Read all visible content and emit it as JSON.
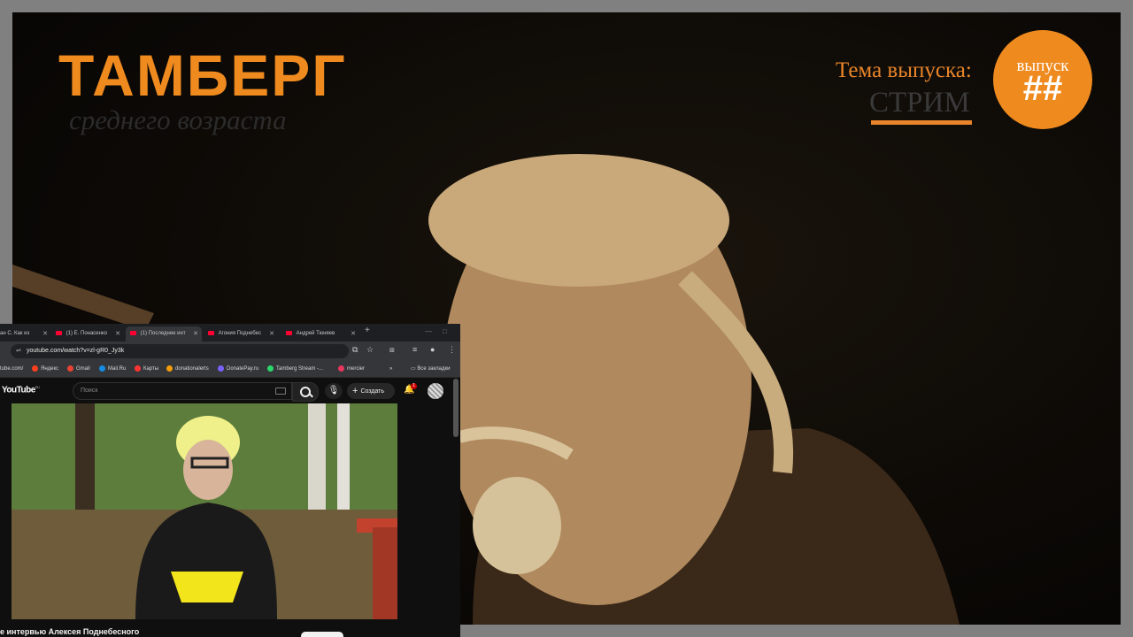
{
  "overlay": {
    "channel_title": "ТАМБЕРГ",
    "channel_subtitle": "среднего возраста",
    "topic_label": "Тема выпуска:",
    "topic_value": "СТРИМ",
    "episode_label": "выпуск",
    "episode_number": "##",
    "accent_color": "#ef8a1f"
  },
  "browser": {
    "tabs": [
      {
        "label": "ан С. Как из",
        "active": false
      },
      {
        "label": "(1) Е. Понасенко",
        "active": false
      },
      {
        "label": "(1) Последнее инт",
        "active": true
      },
      {
        "label": "Агония Поднебес",
        "active": false
      },
      {
        "label": "Андрей Тюняев",
        "active": false
      }
    ],
    "url": "youtube.com/watch?v=zl-gR0_Jy3k",
    "bookmarks": [
      {
        "label": "tube.com/",
        "color": "#888888"
      },
      {
        "label": "Яндекс",
        "color": "#fc3f1d"
      },
      {
        "label": "Gmail",
        "color": "#ea4335"
      },
      {
        "label": "Mail.Ru",
        "color": "#168de2"
      },
      {
        "label": "Карты",
        "color": "#ff3333"
      },
      {
        "label": "donationalerts",
        "color": "#f59c07"
      },
      {
        "label": "DonatePay.ru",
        "color": "#7b61ff"
      },
      {
        "label": "Tamberg Stream -...",
        "color": "#2bd96b"
      },
      {
        "label": "mercier",
        "color": "#e8365d"
      }
    ],
    "bookmarks_all": "Все закладки",
    "youtube": {
      "logo": "YouTube",
      "logo_region": "RU",
      "search_placeholder": "Поиск",
      "create_label": "Создать",
      "notification_count": "1",
      "video_title": "е интервью Алексея Поднебесного"
    }
  }
}
